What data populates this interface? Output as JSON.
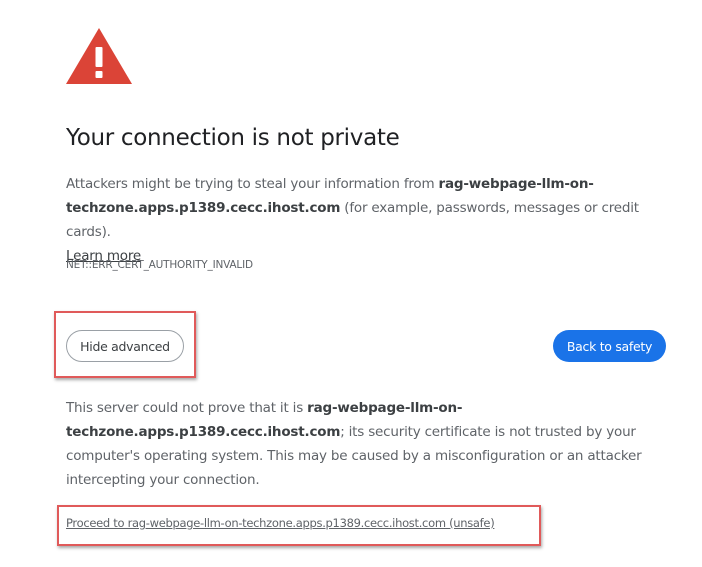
{
  "title": "Your connection is not private",
  "intro": {
    "prefix": "Attackers might be trying to steal your information from ",
    "host": "rag-webpage-llm-on-techzone.apps.p1389.cecc.ihost.com",
    "suffix": " (for example, passwords, messages or credit cards).",
    "learn_more": "Learn more"
  },
  "error_code": "NET::ERR_CERT_AUTHORITY_INVALID",
  "buttons": {
    "hide_advanced": "Hide advanced",
    "back_to_safety": "Back to safety"
  },
  "details": {
    "prefix": "This server could not prove that it is ",
    "host": "rag-webpage-llm-on-techzone.apps.p1389.cecc.ihost.com",
    "suffix": "; its security certificate is not trusted by your computer's operating system. This may be caused by a misconfiguration or an attacker intercepting your connection."
  },
  "proceed_link": "Proceed to rag-webpage-llm-on-techzone.apps.p1389.cecc.ihost.com (unsafe)",
  "icon": "warning-triangle-icon",
  "colors": {
    "warning_red": "#db4437",
    "primary_blue": "#1a73e8",
    "highlight_red": "#e05a5a"
  }
}
